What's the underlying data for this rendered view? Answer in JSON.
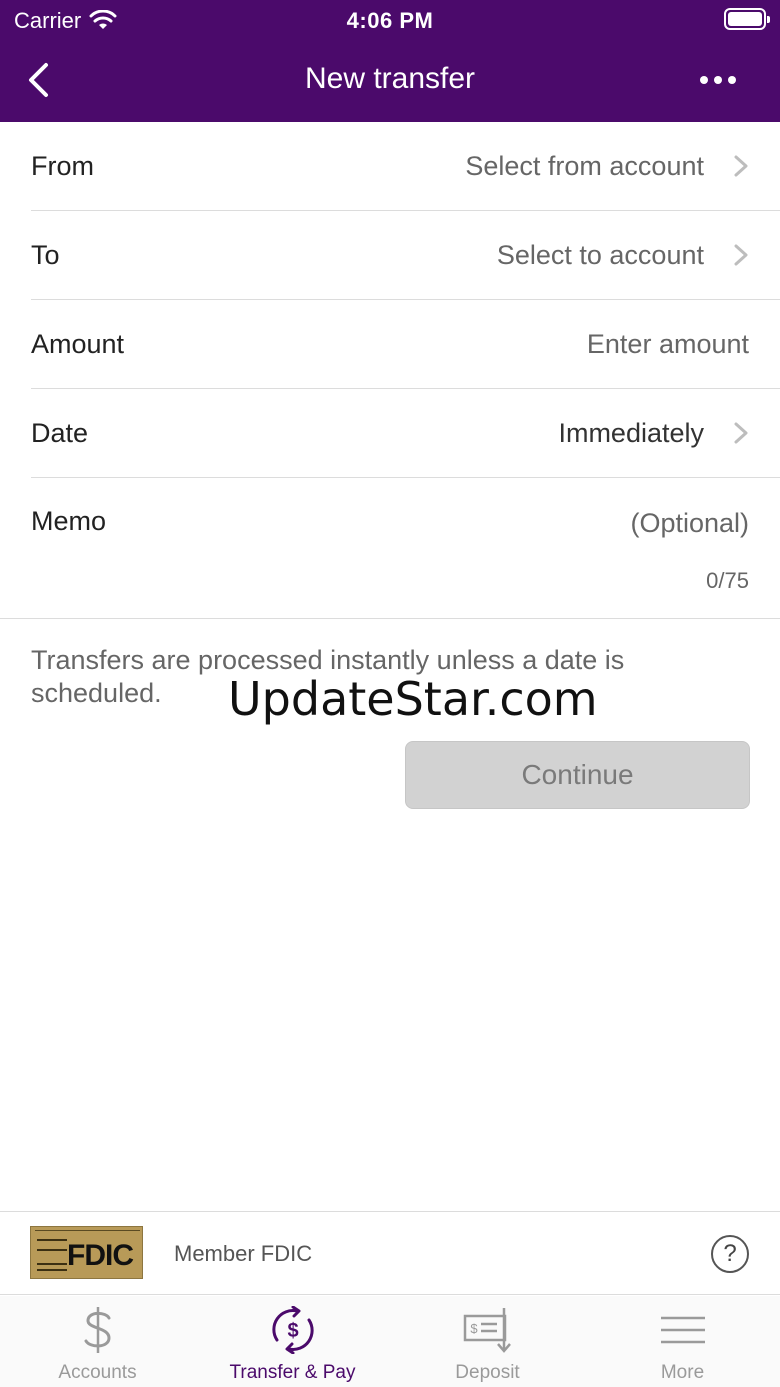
{
  "status_bar": {
    "carrier": "Carrier",
    "time": "4:06 PM"
  },
  "nav": {
    "title": "New transfer",
    "back_icon": "chevron-left-icon",
    "more_icon": "more-horizontal-icon"
  },
  "form": {
    "from": {
      "label": "From",
      "value": "Select from account"
    },
    "to": {
      "label": "To",
      "value": "Select to account"
    },
    "amount": {
      "label": "Amount",
      "placeholder": "Enter amount"
    },
    "date": {
      "label": "Date",
      "value": "Immediately"
    },
    "memo": {
      "label": "Memo",
      "placeholder": "(Optional)",
      "counter": "0/75"
    }
  },
  "note": "Transfers are processed instantly unless a date is scheduled.",
  "watermark": "UpdateStar.com",
  "continue_label": "Continue",
  "footer": {
    "logo_text": "FDIC",
    "member_text": "Member FDIC",
    "help_label": "?"
  },
  "tabs": [
    {
      "label": "Accounts",
      "icon": "dollar-icon"
    },
    {
      "label": "Transfer & Pay",
      "icon": "transfer-pay-icon"
    },
    {
      "label": "Deposit",
      "icon": "check-deposit-icon"
    },
    {
      "label": "More",
      "icon": "menu-icon"
    }
  ],
  "colors": {
    "brand": "#4b0a6b",
    "inactive": "#9a9a9a",
    "button_disabled": "#d2d2d2"
  }
}
